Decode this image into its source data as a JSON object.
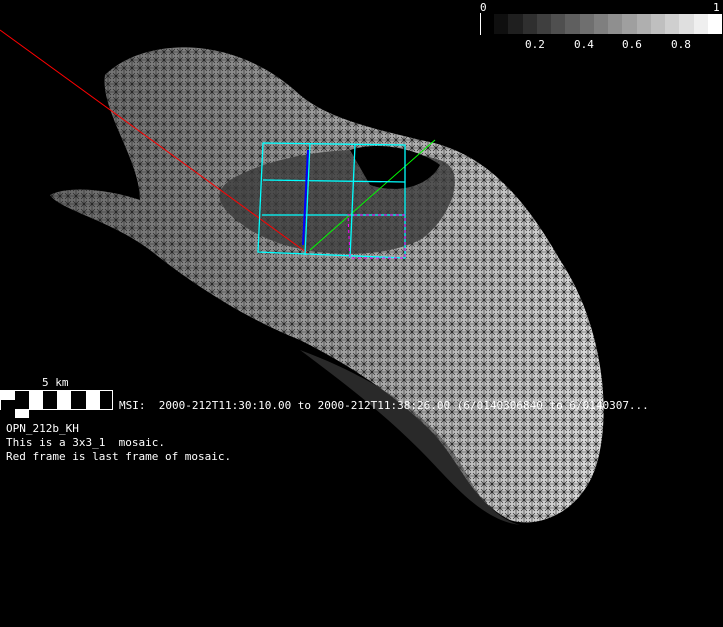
{
  "colorbar": {
    "min_label": "0",
    "max_label": "1",
    "ticks": [
      "0.2",
      "0.4",
      "0.6",
      "0.8"
    ],
    "steps": 16
  },
  "scalebar": {
    "label": "5 km"
  },
  "msi_line": "MSI:  2000-212T11:30:10.00 to 2000-212T11:38:26.00 (6/0140306840 to 6/0140307...",
  "info": {
    "observation": "OPN_212b_KH",
    "mosaic": "This is a 3x3_1  mosaic.",
    "note": "Red frame is last frame of mosaic."
  },
  "colors": {
    "frames": "#00ffff",
    "last_frame": "#ff0000",
    "sun_vector": "#00ff00",
    "highlight": "#ff00ff"
  }
}
